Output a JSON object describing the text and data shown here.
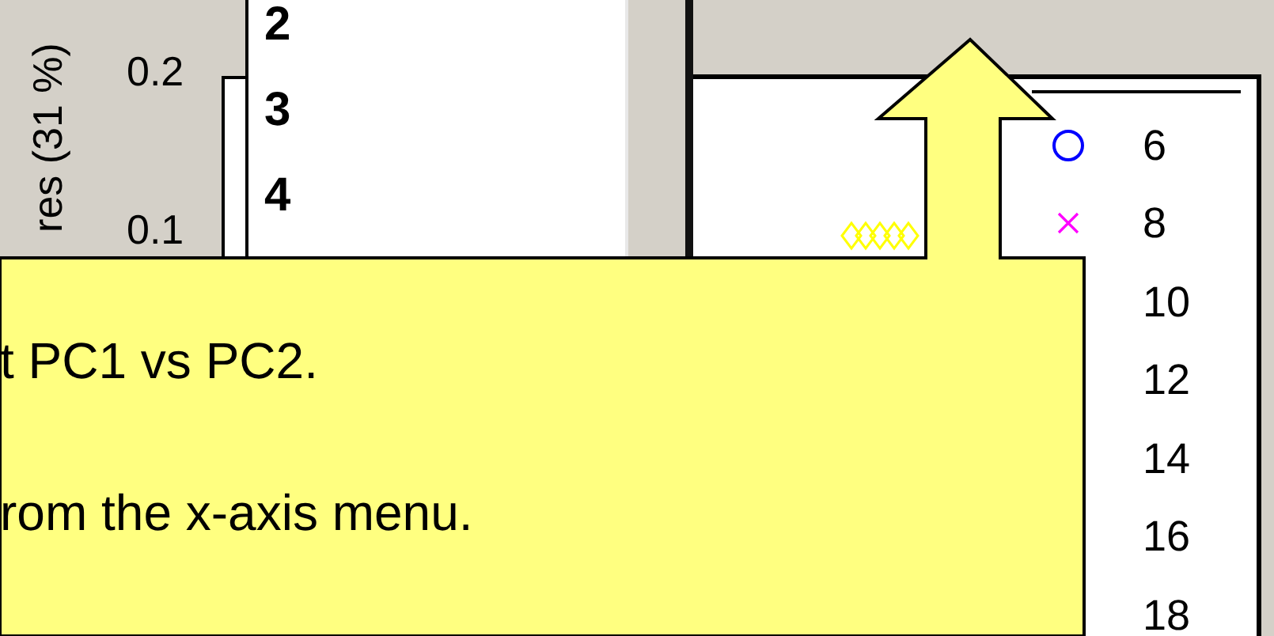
{
  "axis_label": "res (31 %)",
  "y_ticks": [
    "0.2",
    "0.1"
  ],
  "list_items": [
    {
      "label": "2"
    },
    {
      "label": "3"
    },
    {
      "label": "4"
    }
  ],
  "legend": [
    {
      "label": "6",
      "kind": "circle",
      "color": "#0000ff"
    },
    {
      "label": "8",
      "kind": "cross",
      "color": "#ff00ff"
    },
    {
      "label": "10",
      "kind": "plain"
    },
    {
      "label": "12",
      "kind": "plain"
    },
    {
      "label": "14",
      "kind": "plain"
    },
    {
      "label": "16",
      "kind": "plain"
    },
    {
      "label": "18",
      "kind": "plain"
    }
  ],
  "callout": {
    "lines": [
      "t PC1 vs PC2.",
      "rom the x-axis menu."
    ]
  }
}
